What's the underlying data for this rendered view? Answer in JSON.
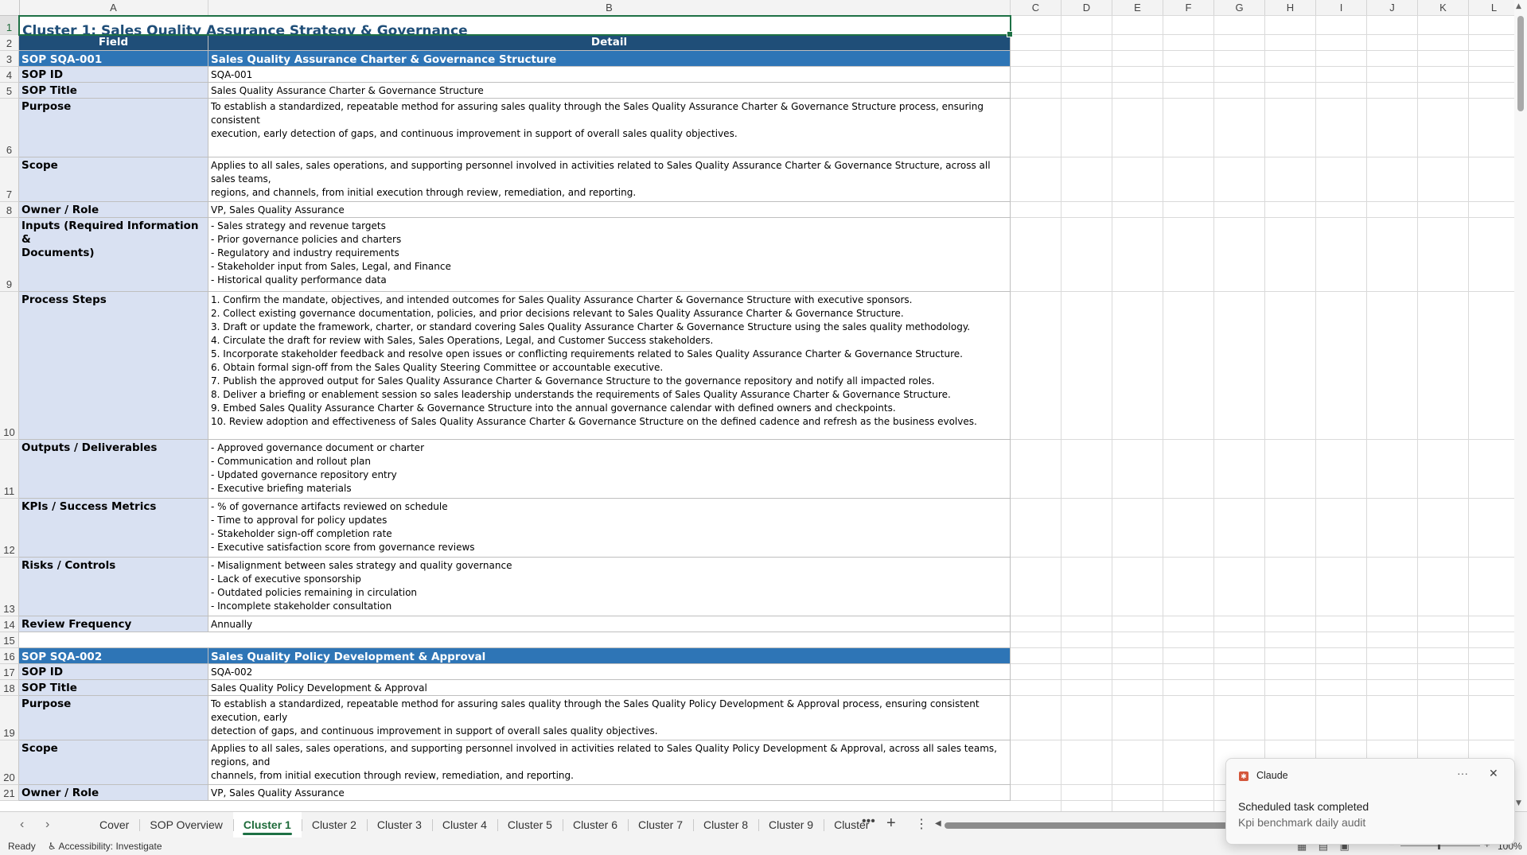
{
  "columns": [
    "A",
    "B",
    "C",
    "D",
    "E",
    "F",
    "G",
    "H",
    "I",
    "J",
    "K",
    "L"
  ],
  "title": "Cluster 1: Sales Quality Assurance Strategy & Governance",
  "header": {
    "field": "Field",
    "detail": "Detail"
  },
  "rows": [
    {
      "num": "1"
    },
    {
      "num": "2"
    },
    {
      "num": "3",
      "a": "SOP SQA-001",
      "b": "Sales Quality Assurance Charter & Governance Structure"
    },
    {
      "num": "4",
      "a": "SOP ID",
      "b": "SQA-001"
    },
    {
      "num": "5",
      "a": "SOP Title",
      "b": "Sales Quality Assurance Charter & Governance Structure"
    },
    {
      "num": "6",
      "a": "Purpose",
      "b": "To establish a standardized, repeatable method for assuring sales quality through the Sales Quality Assurance Charter & Governance Structure process, ensuring consistent\nexecution, early detection of gaps, and continuous improvement in support of overall sales quality objectives."
    },
    {
      "num": "7",
      "a": "Scope",
      "b": "Applies to all sales, sales operations, and supporting personnel involved in activities related to Sales Quality Assurance Charter & Governance Structure, across all sales teams,\nregions, and channels, from initial execution through review, remediation, and reporting."
    },
    {
      "num": "8",
      "a": "Owner / Role",
      "b": "VP, Sales Quality Assurance"
    },
    {
      "num": "9",
      "a": "Inputs (Required Information &\nDocuments)",
      "b": "- Sales strategy and revenue targets\n- Prior governance policies and charters\n- Regulatory and industry requirements\n- Stakeholder input from Sales, Legal, and Finance\n- Historical quality performance data"
    },
    {
      "num": "10",
      "a": "Process Steps",
      "b": "1. Confirm the mandate, objectives, and intended outcomes for Sales Quality Assurance Charter & Governance Structure with executive sponsors.\n2. Collect existing governance documentation, policies, and prior decisions relevant to Sales Quality Assurance Charter & Governance Structure.\n3. Draft or update the framework, charter, or standard covering Sales Quality Assurance Charter & Governance Structure using the sales quality methodology.\n4. Circulate the draft for review with Sales, Sales Operations, Legal, and Customer Success stakeholders.\n5. Incorporate stakeholder feedback and resolve open issues or conflicting requirements related to Sales Quality Assurance Charter & Governance Structure.\n6. Obtain formal sign-off from the Sales Quality Steering Committee or accountable executive.\n7. Publish the approved output for Sales Quality Assurance Charter & Governance Structure to the governance repository and notify all impacted roles.\n8. Deliver a briefing or enablement session so sales leadership understands the requirements of Sales Quality Assurance Charter & Governance Structure.\n9. Embed Sales Quality Assurance Charter & Governance Structure into the annual governance calendar with defined owners and checkpoints.\n10. Review adoption and effectiveness of Sales Quality Assurance Charter & Governance Structure on the defined cadence and refresh as the business evolves."
    },
    {
      "num": "11",
      "a": "Outputs / Deliverables",
      "b": "- Approved governance document or charter\n- Communication and rollout plan\n- Updated governance repository entry\n- Executive briefing materials"
    },
    {
      "num": "12",
      "a": "KPIs / Success Metrics",
      "b": "- % of governance artifacts reviewed on schedule\n- Time to approval for policy updates\n- Stakeholder sign-off completion rate\n- Executive satisfaction score from governance reviews"
    },
    {
      "num": "13",
      "a": "Risks / Controls",
      "b": "- Misalignment between sales strategy and quality governance\n- Lack of executive sponsorship\n- Outdated policies remaining in circulation\n- Incomplete stakeholder consultation"
    },
    {
      "num": "14",
      "a": "Review Frequency",
      "b": "Annually"
    },
    {
      "num": "15"
    },
    {
      "num": "16",
      "a": "SOP SQA-002",
      "b": "Sales Quality Policy Development & Approval"
    },
    {
      "num": "17",
      "a": "SOP ID",
      "b": "SQA-002"
    },
    {
      "num": "18",
      "a": "SOP Title",
      "b": "Sales Quality Policy Development & Approval"
    },
    {
      "num": "19",
      "a": "Purpose",
      "b": "To establish a standardized, repeatable method for assuring sales quality through the Sales Quality Policy Development & Approval process, ensuring consistent execution, early\ndetection of gaps, and continuous improvement in support of overall sales quality objectives."
    },
    {
      "num": "20",
      "a": "Scope",
      "b": "Applies to all sales, sales operations, and supporting personnel involved in activities related to Sales Quality Policy Development & Approval, across all sales teams, regions, and\nchannels, from initial execution through review, remediation, and reporting."
    },
    {
      "num": "21",
      "a": "Owner / Role",
      "b": "VP, Sales Quality Assurance"
    }
  ],
  "tabs": [
    "Cover",
    "SOP Overview",
    "Cluster 1",
    "Cluster 2",
    "Cluster 3",
    "Cluster 4",
    "Cluster 5",
    "Cluster 6",
    "Cluster 7",
    "Cluster 8",
    "Cluster 9",
    "Cluster"
  ],
  "active_tab": "Cluster 1",
  "status": {
    "ready": "Ready",
    "accessibility": "Accessibility: Investigate",
    "zoom": "100%"
  },
  "toast": {
    "app": "Claude",
    "title": "Scheduled task completed",
    "message": "Kpi benchmark daily audit"
  },
  "colors": {
    "section": "#2e75b6",
    "header": "#1f4e78",
    "field_bg": "#d9e1f2",
    "accent": "#1e7145"
  }
}
